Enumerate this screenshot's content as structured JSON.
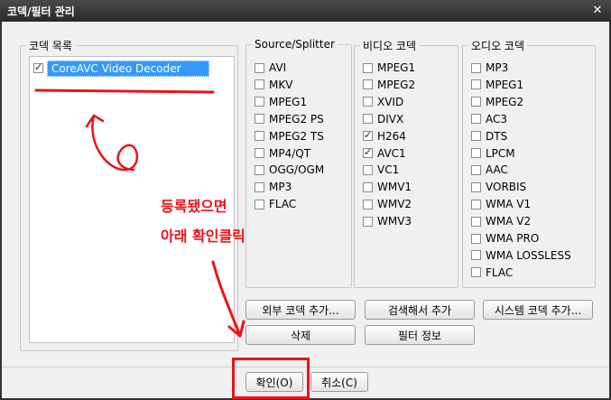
{
  "window": {
    "title": "코덱/필터 관리"
  },
  "codec_list": {
    "legend": "코덱 목록",
    "items": [
      {
        "label": "CoreAVC Video Decoder",
        "checked": true
      }
    ]
  },
  "source_splitter": {
    "legend": "Source/Splitter",
    "items": [
      {
        "label": "AVI",
        "checked": false
      },
      {
        "label": "MKV",
        "checked": false
      },
      {
        "label": "MPEG1",
        "checked": false
      },
      {
        "label": "MPEG2 PS",
        "checked": false
      },
      {
        "label": "MPEG2 TS",
        "checked": false
      },
      {
        "label": "MP4/QT",
        "checked": false
      },
      {
        "label": "OGG/OGM",
        "checked": false
      },
      {
        "label": "MP3",
        "checked": false
      },
      {
        "label": "FLAC",
        "checked": false
      }
    ]
  },
  "video_codec": {
    "legend": "비디오 코덱",
    "items": [
      {
        "label": "MPEG1",
        "checked": false
      },
      {
        "label": "MPEG2",
        "checked": false
      },
      {
        "label": "XVID",
        "checked": false
      },
      {
        "label": "DIVX",
        "checked": false
      },
      {
        "label": "H264",
        "checked": true
      },
      {
        "label": "AVC1",
        "checked": true
      },
      {
        "label": "VC1",
        "checked": false
      },
      {
        "label": "WMV1",
        "checked": false
      },
      {
        "label": "WMV2",
        "checked": false
      },
      {
        "label": "WMV3",
        "checked": false
      }
    ]
  },
  "audio_codec": {
    "legend": "오디오 코덱",
    "items": [
      {
        "label": "MP3",
        "checked": false
      },
      {
        "label": "MPEG1",
        "checked": false
      },
      {
        "label": "MPEG2",
        "checked": false
      },
      {
        "label": "AC3",
        "checked": false
      },
      {
        "label": "DTS",
        "checked": false
      },
      {
        "label": "LPCM",
        "checked": false
      },
      {
        "label": "AAC",
        "checked": false
      },
      {
        "label": "VORBIS",
        "checked": false
      },
      {
        "label": "WMA V1",
        "checked": false
      },
      {
        "label": "WMA V2",
        "checked": false
      },
      {
        "label": "WMA PRO",
        "checked": false
      },
      {
        "label": "WMA LOSSLESS",
        "checked": false
      },
      {
        "label": "FLAC",
        "checked": false
      }
    ]
  },
  "buttons": {
    "add_external": "외부 코덱 추가...",
    "search_add": "검색해서 추가",
    "add_system": "시스템 코덱 추가...",
    "delete": "삭제",
    "filter_info": "필터 정보",
    "ok": "확인(O)",
    "cancel": "취소(C)"
  },
  "annotation": {
    "line1": "등록됐으면",
    "line2": "아래 확인클릭",
    "color": "#e8141b"
  }
}
